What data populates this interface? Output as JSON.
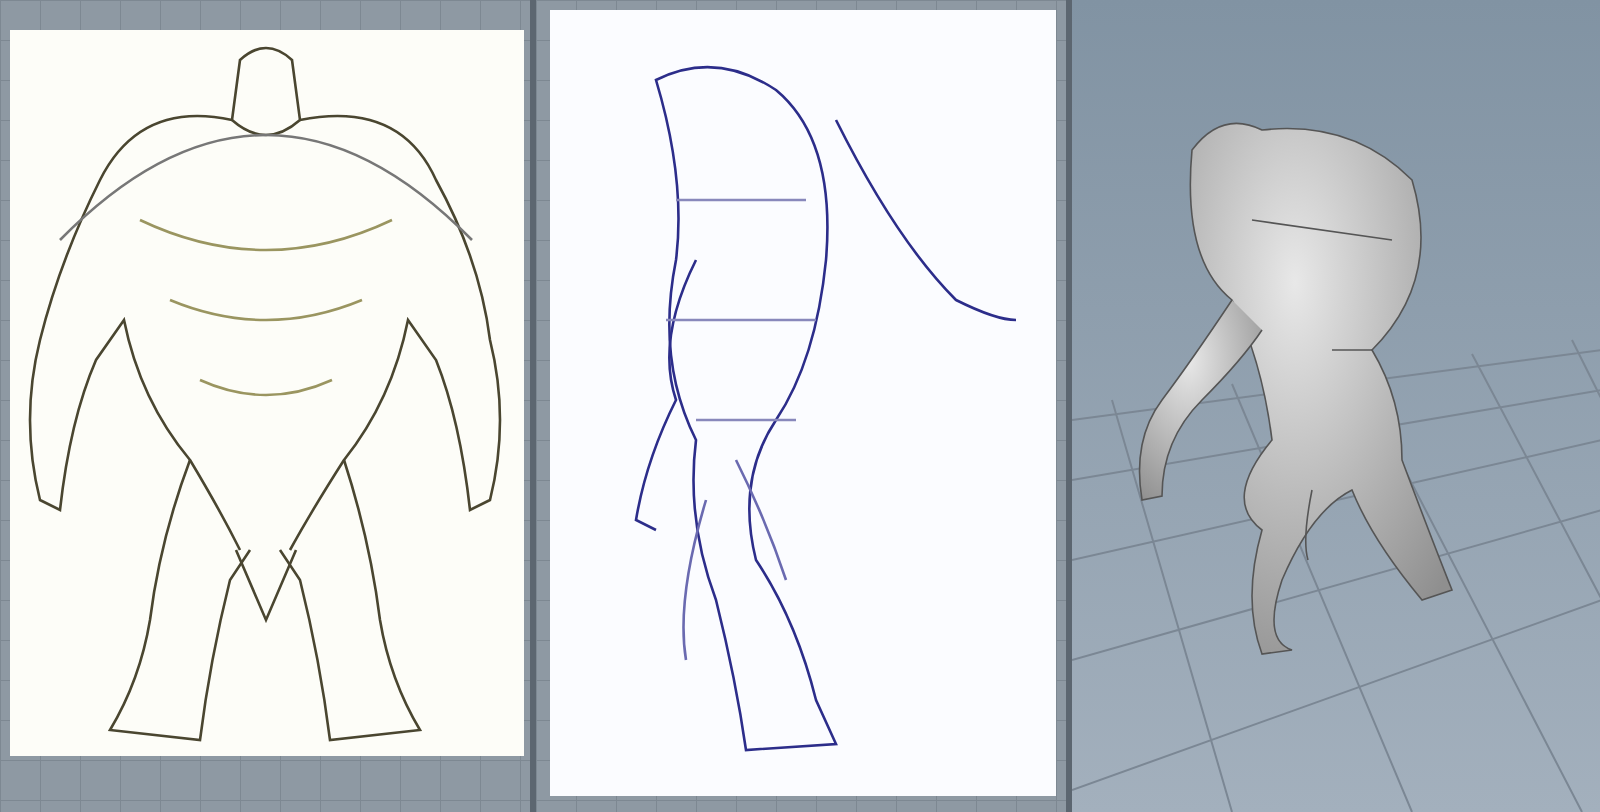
{
  "viewports": [
    {
      "kind": "front_sketch"
    },
    {
      "kind": "side_sketch"
    },
    {
      "kind": "model_3d"
    }
  ]
}
